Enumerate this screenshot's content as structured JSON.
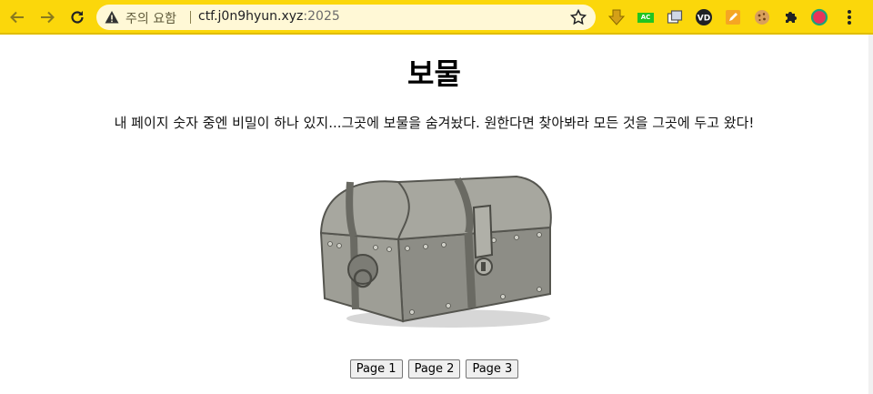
{
  "browser": {
    "security_chip": "주의 요함",
    "url_host": "ctf.j0n9hyun.xyz",
    "url_port": ":2025",
    "theme_color": "#fbd70b",
    "ac_badge": "AC"
  },
  "page": {
    "title": "보물",
    "description": "내 페이지 숫자 중엔 비밀이 하나 있지...그곳에 보물을 숨겨놨다. 원한다면 찾아봐라 모든 것을 그곳에 두고 왔다!",
    "image_icon": "treasure-chest",
    "buttons": [
      "Page 1",
      "Page 2",
      "Page 3"
    ]
  }
}
